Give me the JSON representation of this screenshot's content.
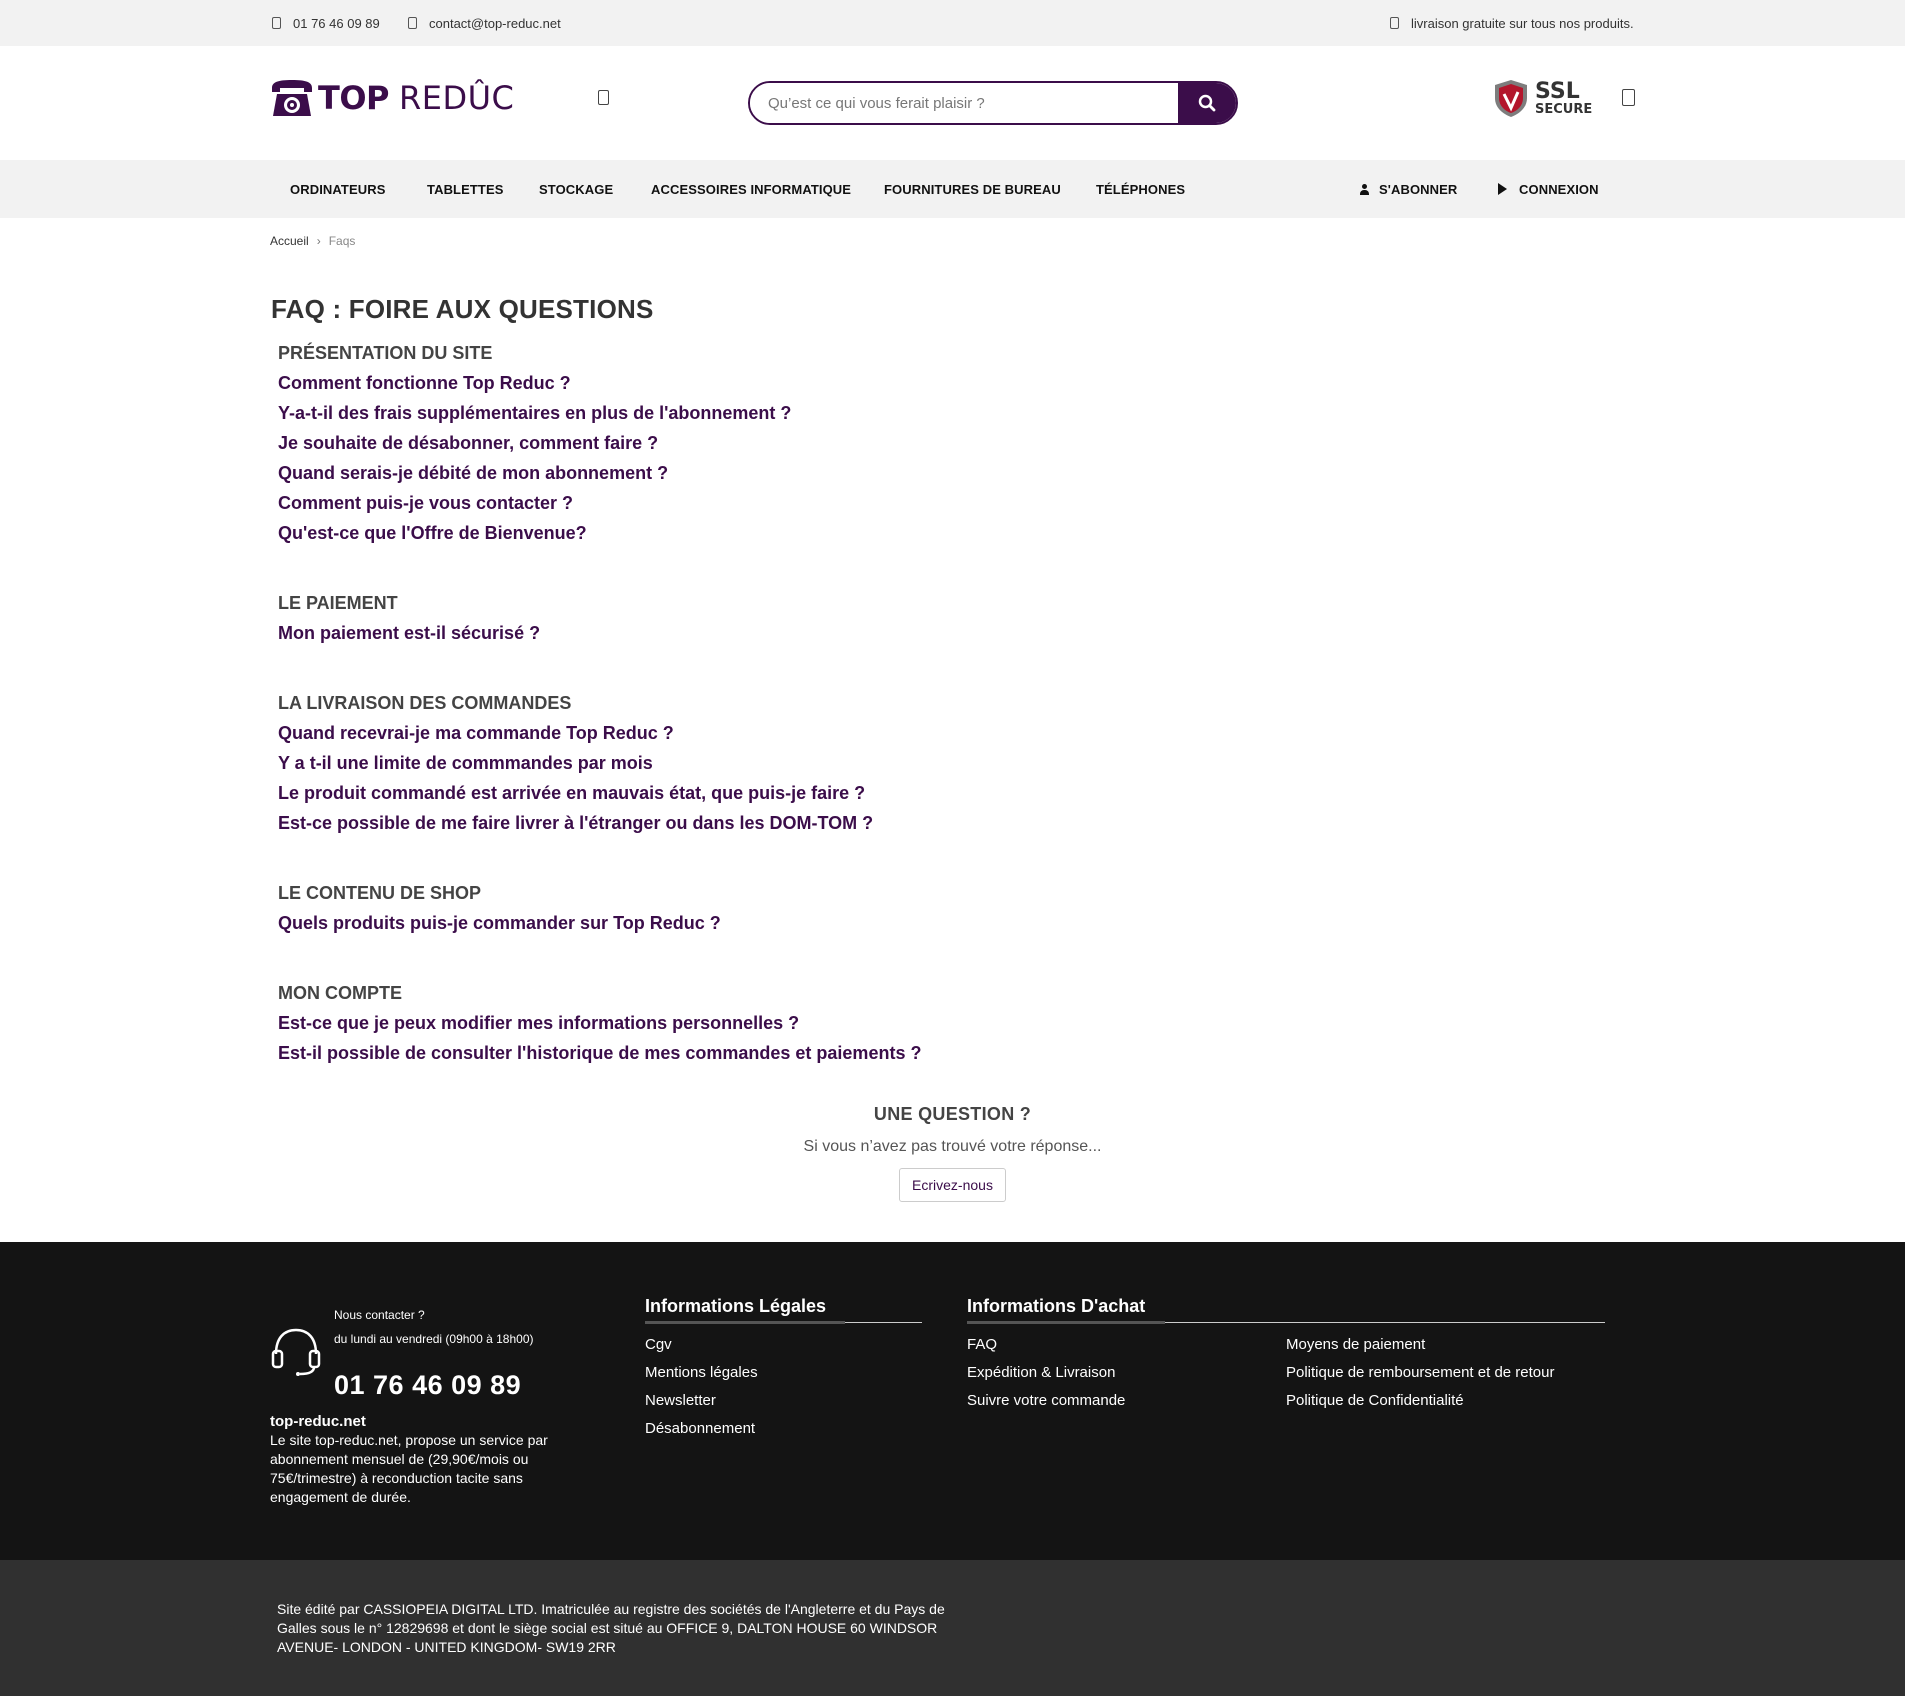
{
  "topbar": {
    "phone": "01 76 46 09 89",
    "email": "contact@top-reduc.net",
    "shipping": "livraison gratuite sur tous nos produits."
  },
  "header": {
    "logo_top": "TOP",
    "logo_reduc": "REDÛC",
    "search_placeholder": "Qu’est ce qui vous ferait plaisir ?",
    "ssl_line1": "SSL",
    "ssl_line2": "SECURE"
  },
  "nav": {
    "items": [
      "ORDINATEURS",
      "TABLETTES",
      "STOCKAGE",
      "ACCESSOIRES INFORMATIQUE",
      "FOURNITURES DE BUREAU",
      "TÉLÉPHONES"
    ],
    "subscribe": "S'ABONNER",
    "login": "CONNEXION"
  },
  "breadcrumb": {
    "home": "Accueil",
    "separator": "›",
    "current": "Faqs"
  },
  "faq": {
    "title": "FAQ : FOIRE AUX QUESTIONS",
    "sections": [
      {
        "title": "PRÉSENTATION DU SITE",
        "questions": [
          "Comment fonctionne Top Reduc ?",
          "Y-a-t-il des frais supplémentaires en plus de l'abonnement ?",
          "Je souhaite de désabonner, comment faire ?",
          "Quand serais-je débité de mon abonnement ?",
          "Comment puis-je vous contacter ?",
          "Qu'est-ce que l'Offre de Bienvenue?"
        ]
      },
      {
        "title": "LE PAIEMENT",
        "questions": [
          "Mon paiement est-il sécurisé ?"
        ]
      },
      {
        "title": "LA LIVRAISON DES COMMANDES",
        "questions": [
          "Quand recevrai-je ma commande Top Reduc ?",
          "Y a t-il une limite de commmandes par mois",
          "Le produit commandé est arrivée en mauvais état, que puis-je faire ?",
          "Est-ce possible de me faire livrer à l'étranger ou dans les DOM-TOM ?"
        ]
      },
      {
        "title": "LE CONTENU DE SHOP",
        "questions": [
          "Quels produits puis-je commander sur Top Reduc ?"
        ]
      },
      {
        "title": "MON COMPTE",
        "questions": [
          "Est-ce que je peux modifier mes informations personnelles ?",
          "Est-il possible de consulter l'historique de mes commandes et paiements ?"
        ]
      }
    ]
  },
  "ask": {
    "title": "UNE QUESTION ?",
    "subtitle": "Si vous n’avez pas trouvé votre réponse...",
    "button": "Ecrivez-nous"
  },
  "footer": {
    "contact_label": "Nous contacter ?",
    "contact_hours": "du lundi au vendredi (09h00 à 18h00)",
    "contact_phone": "01 76 46 09 89",
    "about_title": "top-reduc.net",
    "about_text": "Le site top-reduc.net, propose un service par abonnement mensuel de (29,90€/mois ou 75€/trimestre) à reconduction tacite sans engagement de durée.",
    "legal_title": "Informations Légales",
    "legal_links": [
      "Cgv",
      "Mentions légales",
      "Newsletter",
      "Désabonnement"
    ],
    "purchase_title": "Informations D'achat",
    "purchase_links_col1": [
      "FAQ",
      "Expédition & Livraison",
      "Suivre votre commande"
    ],
    "purchase_links_col2": [
      "Moyens de paiement",
      "Politique de remboursement et de retour",
      "Politique de Confidentialité"
    ]
  },
  "subfooter": {
    "legal_text": "Site édité par CASSIOPEIA DIGITAL LTD. Imatriculée au registre des sociétés de l'Angleterre et du Pays de Galles sous le n° 12829698 et dont le siège social est situé au OFFICE 9, DALTON HOUSE 60 WINDSOR AVENUE- LONDON - UNITED KINGDOM- SW19 2RR"
  },
  "colors": {
    "brand": "#3b0d4a",
    "footer_bg": "#141414",
    "subfooter_bg": "#303030",
    "bar_bg": "#f2f2f2"
  },
  "icons": [
    "phone-icon",
    "mail-icon",
    "truck-icon",
    "menu-icon",
    "search-icon",
    "ssl-shield-icon",
    "cart-icon",
    "user-icon",
    "play-icon",
    "headset-icon"
  ]
}
